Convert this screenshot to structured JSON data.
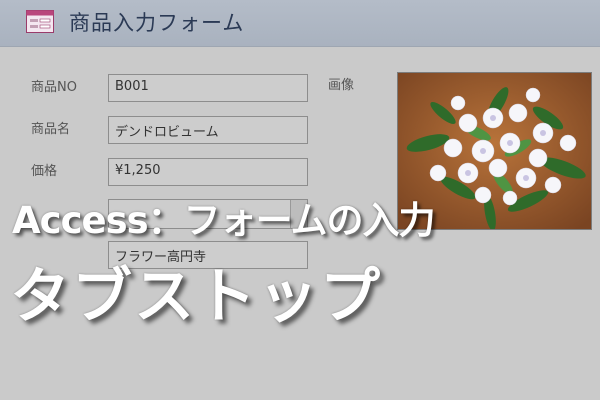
{
  "window": {
    "title": "商品入力フォーム",
    "icon": "form-icon"
  },
  "form": {
    "fields": [
      {
        "label": "商品NO",
        "value": "B001"
      },
      {
        "label": "商品名",
        "value": "デンドロビューム"
      },
      {
        "label": "価格",
        "value": "¥1,250"
      },
      {
        "label": "",
        "value": ""
      },
      {
        "label": "",
        "value": "フラワー高円寺"
      }
    ],
    "image_label": "画像",
    "image_subject": "white-orchid-flower-arrangement"
  },
  "overlay": {
    "line1": "Access：フォームの入力",
    "line2": "タブストップ"
  },
  "colors": {
    "titlebar": "#aab3c0",
    "background": "#cacaca",
    "title_text": "#2b3a55",
    "overlay_text": "#ffffff"
  }
}
